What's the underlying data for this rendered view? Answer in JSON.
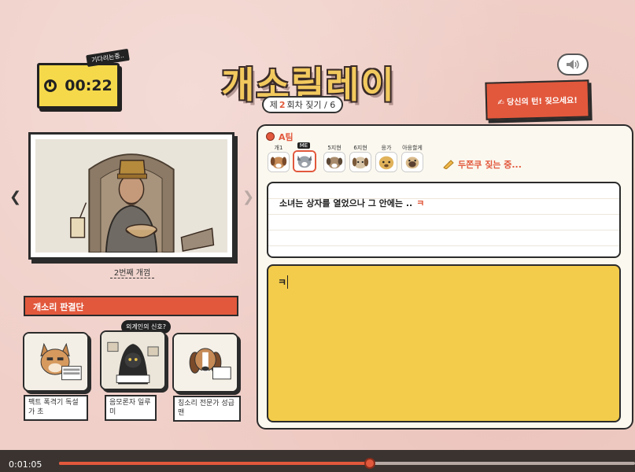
{
  "timer": {
    "tag": "기다리는중..",
    "time": "00:22"
  },
  "title": "개소릴레이",
  "round": {
    "prefix": "제",
    "num": "2",
    "suffix": "회차 짖기 / 6"
  },
  "turn_banner": "✍ 당신의 턴! 짖으세요!",
  "image_caption": "2번째 개껌",
  "judges": {
    "header": "개소리 판결단",
    "speech_tag": "외계인의 신호?",
    "cards": [
      {
        "name": "팩트 폭격기 독설가 초"
      },
      {
        "name": "음모론자 일루미"
      },
      {
        "name": "칭소리 전문가 성급맨"
      }
    ]
  },
  "team": {
    "label": "A팀",
    "me_label": "ME",
    "players": [
      {
        "label": "개1"
      },
      {
        "label": ""
      },
      {
        "label": "5지현"
      },
      {
        "label": "6지현"
      },
      {
        "label": "응가"
      },
      {
        "label": "아응할게"
      }
    ],
    "typing_status": "두쫀쿠 짖는 중..."
  },
  "story": {
    "text": "소녀는 상자를 열었으나 그 안에는 ..",
    "accent": "ㅋ"
  },
  "input": {
    "value": "ㅋ"
  },
  "playback": {
    "current_time": "0:01:05",
    "progress": 0.54
  },
  "colors": {
    "accent": "#e2583c",
    "yellow": "#f3cc4b",
    "bg": "#f0cfc8"
  }
}
